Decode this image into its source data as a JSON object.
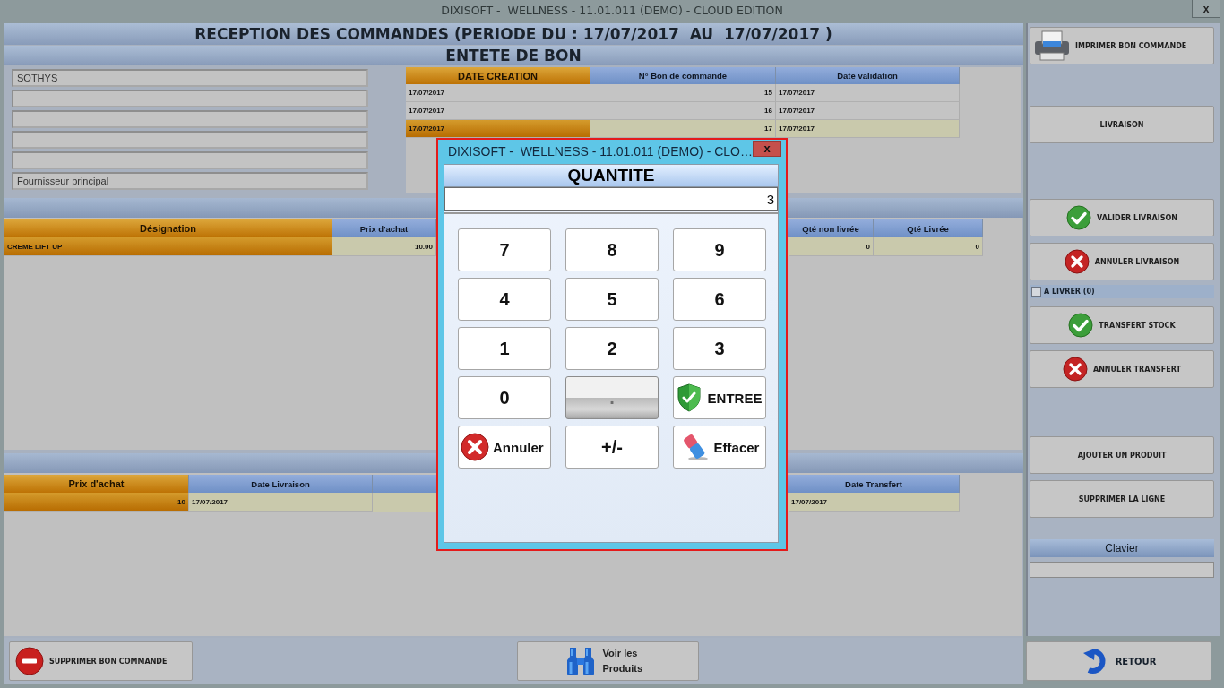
{
  "window": {
    "title": "DIXISOFT -  WELLNESS - 11.01.011 (DEMO) - CLOUD EDITION",
    "close": "x"
  },
  "header": {
    "title": "RECEPTION DES COMMANDES (PERIODE DU : 17/07/2017  AU  17/07/2017 )",
    "subtitle": "ENTETE DE BON"
  },
  "supplier": {
    "name": "SOTHYS",
    "role": "Fournisseur principal"
  },
  "orders_table": {
    "columns": [
      {
        "label": "DATE CREATION",
        "kind": "text",
        "selected": true
      },
      {
        "label": "N° Bon de commande",
        "kind": "number",
        "selected": false
      },
      {
        "label": "Date validation",
        "kind": "text",
        "selected": false
      }
    ],
    "rows": [
      {
        "selected": false,
        "cells": [
          "17/07/2017",
          "15",
          "17/07/2017"
        ]
      },
      {
        "selected": false,
        "cells": [
          "17/07/2017",
          "16",
          "17/07/2017"
        ]
      },
      {
        "selected": true,
        "cells": [
          "17/07/2017",
          "17",
          "17/07/2017"
        ]
      }
    ]
  },
  "lines_table": {
    "columns": [
      {
        "label": "Désignation",
        "kind": "text",
        "selected": true
      },
      {
        "label": "Prix d'achat",
        "kind": "number",
        "selected": false
      },
      {
        "label": "Qté non livrée",
        "kind": "number",
        "selected": false
      },
      {
        "label": "Qté Livrée",
        "kind": "number",
        "selected": false
      }
    ],
    "rows": [
      {
        "selected": true,
        "cells": [
          "CREME LIFT UP",
          "10.00",
          "0",
          "0"
        ]
      }
    ]
  },
  "deliveries_table": {
    "columns": [
      {
        "label": "Prix d'achat",
        "kind": "number",
        "selected": true
      },
      {
        "label": "Date Livraison",
        "kind": "text",
        "selected": false
      },
      {
        "label": "Date Transfert",
        "kind": "text",
        "selected": false
      }
    ],
    "rows": [
      {
        "selected": true,
        "cells": [
          "10",
          "17/07/2017",
          "17/07/2017"
        ]
      }
    ]
  },
  "bottom_bar": {
    "delete_order": "SUPPRIMER BON COMMANDE",
    "view_products": "Voir les Produits"
  },
  "side_panel": {
    "delivery_buttons": [
      {
        "kind": "print",
        "label": "IMPRIMER BON COMMANDE"
      },
      {
        "kind": "plain",
        "label": "LIVRAISON"
      },
      {
        "kind": "confirm",
        "label": "VALIDER LIVRAISON"
      },
      {
        "kind": "cancel",
        "label": "ANNULER LIVRAISON"
      }
    ],
    "to_deliver": {
      "label": "A LIVRER (0)",
      "checked": false
    },
    "transfer_buttons": [
      {
        "kind": "confirm",
        "label": "TRANSFERT STOCK"
      },
      {
        "kind": "cancel",
        "label": "ANNULER TRANSFERT"
      }
    ],
    "line_buttons": [
      "AJOUTER UN PRODUIT",
      "SUPPRIMER LA LIGNE"
    ],
    "keyboard": {
      "title": "Clavier"
    },
    "return_button": "RETOUR"
  },
  "dialog": {
    "title": "DIXISOFT -  WELLNESS - 11.01.011 (DEMO) - CLO…",
    "close": "x",
    "heading": "QUANTITE",
    "value": "3",
    "keys": [
      {
        "label": "7",
        "kind": "digit",
        "disabled": false
      },
      {
        "label": "8",
        "kind": "digit",
        "disabled": false
      },
      {
        "label": "9",
        "kind": "digit",
        "disabled": false
      },
      {
        "label": "4",
        "kind": "digit",
        "disabled": false
      },
      {
        "label": "5",
        "kind": "digit",
        "disabled": false
      },
      {
        "label": "6",
        "kind": "digit",
        "disabled": false
      },
      {
        "label": "1",
        "kind": "digit",
        "disabled": false
      },
      {
        "label": "2",
        "kind": "digit",
        "disabled": false
      },
      {
        "label": "3",
        "kind": "digit",
        "disabled": false
      },
      {
        "label": "0",
        "kind": "digit",
        "disabled": false
      },
      {
        "label": ".",
        "kind": "digit",
        "disabled": true
      },
      {
        "label": "ENTREE",
        "kind": "enter",
        "disabled": false
      },
      {
        "label": "Annuler",
        "kind": "cancel",
        "disabled": false
      },
      {
        "label": "+/-",
        "kind": "digit",
        "disabled": false
      },
      {
        "label": "Effacer",
        "kind": "clear",
        "disabled": false
      }
    ]
  }
}
